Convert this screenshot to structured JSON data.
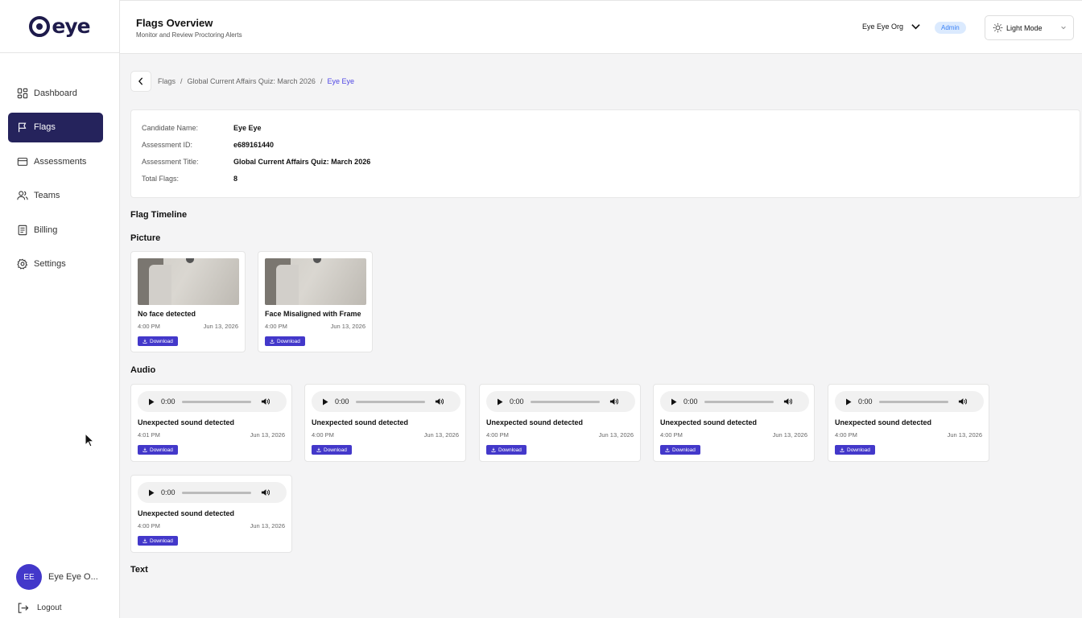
{
  "brand": {
    "logo_text": "eye"
  },
  "sidebar": {
    "items": [
      {
        "label": "Dashboard",
        "icon": "dashboard-icon",
        "active": false
      },
      {
        "label": "Flags",
        "icon": "flag-icon",
        "active": true
      },
      {
        "label": "Assessments",
        "icon": "card-icon",
        "active": false
      },
      {
        "label": "Teams",
        "icon": "users-icon",
        "active": false
      },
      {
        "label": "Billing",
        "icon": "receipt-icon",
        "active": false
      },
      {
        "label": "Settings",
        "icon": "gear-icon",
        "active": false
      }
    ],
    "user": {
      "initials": "EE",
      "name": "Eye Eye O..."
    },
    "logout_label": "Logout"
  },
  "header": {
    "title": "Flags Overview",
    "subtitle": "Monitor and Review Proctoring Alerts",
    "org_name": "Eye Eye Org",
    "role": "Admin",
    "theme": "Light Mode"
  },
  "breadcrumb": {
    "items": [
      "Flags",
      "Global Current Affairs Quiz: March 2026",
      "Eye Eye"
    ],
    "separator": "/"
  },
  "candidate": {
    "name_label": "Candidate Name:",
    "name": "Eye Eye",
    "id_label": "Assessment ID:",
    "id": "e689161440",
    "title_label": "Assessment Title:",
    "title": "Global Current Affairs Quiz: March 2026",
    "flags_label": "Total Flags:",
    "flags": "8"
  },
  "timeline": {
    "title": "Flag Timeline",
    "picture_title": "Picture",
    "audio_title": "Audio",
    "text_title": "Text",
    "download_label": "Download",
    "pictures": [
      {
        "title": "No face detected",
        "time": "4:00 PM",
        "date": "Jun 13, 2026"
      },
      {
        "title": "Face Misaligned with Frame",
        "time": "4:00 PM",
        "date": "Jun 13, 2026"
      }
    ],
    "audio": [
      {
        "player_time": "0:00",
        "title": "Unexpected sound detected",
        "time": "4:01 PM",
        "date": "Jun 13, 2026"
      },
      {
        "player_time": "0:00",
        "title": "Unexpected sound detected",
        "time": "4:00 PM",
        "date": "Jun 13, 2026"
      },
      {
        "player_time": "0:00",
        "title": "Unexpected sound detected",
        "time": "4:00 PM",
        "date": "Jun 13, 2026"
      },
      {
        "player_time": "0:00",
        "title": "Unexpected sound detected",
        "time": "4:00 PM",
        "date": "Jun 13, 2026"
      },
      {
        "player_time": "0:00",
        "title": "Unexpected sound detected",
        "time": "4:00 PM",
        "date": "Jun 13, 2026"
      },
      {
        "player_time": "0:00",
        "title": "Unexpected sound detected",
        "time": "4:00 PM",
        "date": "Jun 13, 2026"
      }
    ]
  },
  "colors": {
    "primary": "#25235c",
    "accent": "#4338ca",
    "link": "#4f46e5"
  }
}
